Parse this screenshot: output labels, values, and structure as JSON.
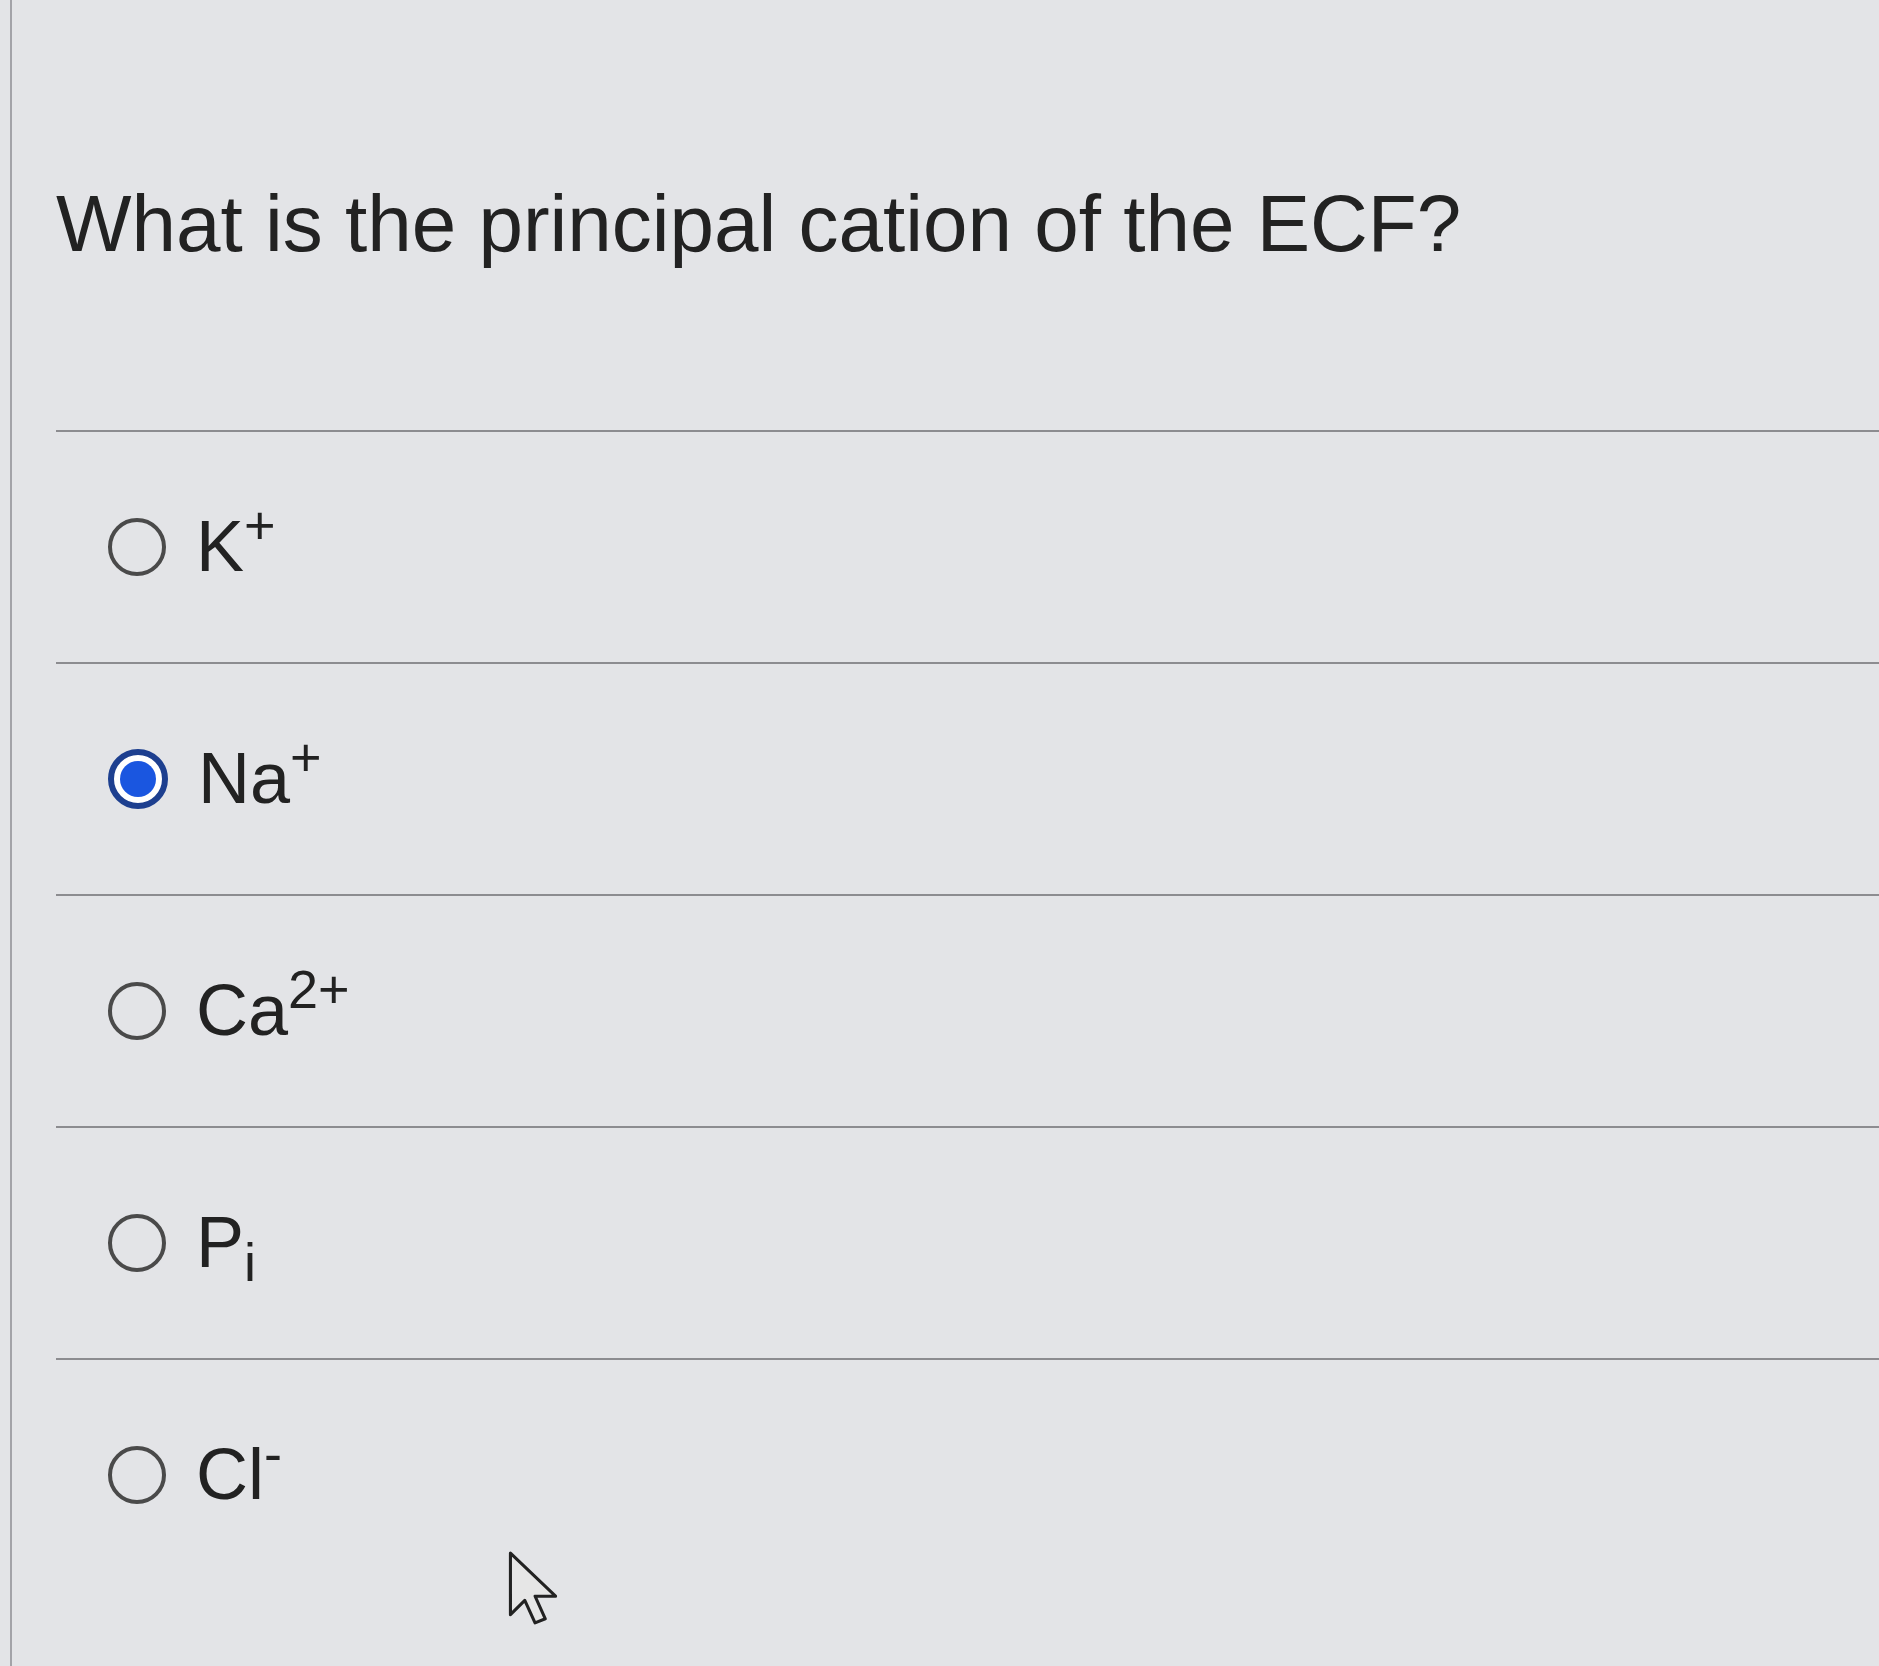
{
  "question": {
    "text": "What is the principal cation of the ECF?"
  },
  "options": [
    {
      "label": "K$^{+}$",
      "selected": false
    },
    {
      "label": "Na$^{+}$",
      "selected": true
    },
    {
      "label": "Ca$^{2+}$",
      "selected": false
    },
    {
      "label": "P$_{i}$",
      "selected": false
    },
    {
      "label": "Cl$^{-}$",
      "selected": false
    }
  ]
}
